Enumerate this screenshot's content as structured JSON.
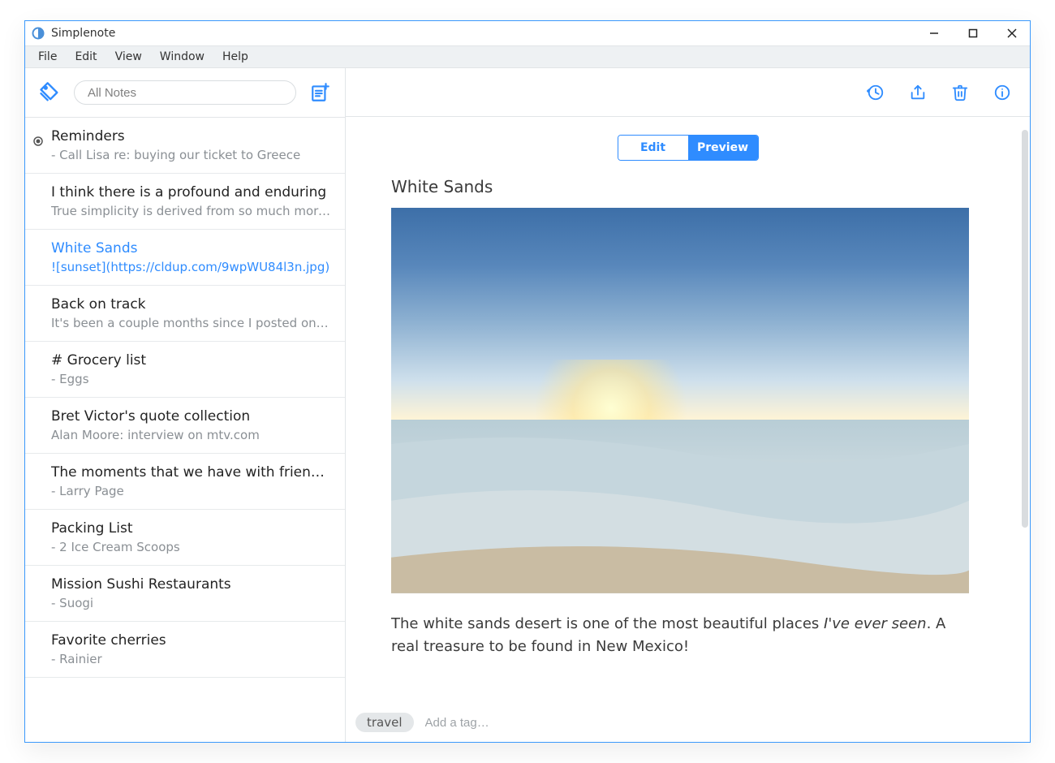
{
  "app_title": "Simplenote",
  "menu": [
    "File",
    "Edit",
    "View",
    "Window",
    "Help"
  ],
  "search_placeholder": "All Notes",
  "notes": [
    {
      "title": "Reminders",
      "snippet": "- Call Lisa re: buying our ticket to Greece",
      "pinned": true,
      "selected": false
    },
    {
      "title": "I think there is a profound and enduring",
      "snippet": "True simplicity is derived from so much more t…",
      "pinned": false,
      "selected": false
    },
    {
      "title": "White Sands",
      "snippet": "![sunset](https://cldup.com/9wpWU84l3n.jpg)",
      "pinned": false,
      "selected": true
    },
    {
      "title": "Back on track",
      "snippet": "It's been a couple months since I posted on my…",
      "pinned": false,
      "selected": false
    },
    {
      "title": "# Grocery list",
      "snippet": "- Eggs",
      "pinned": false,
      "selected": false
    },
    {
      "title": "Bret Victor's quote collection",
      "snippet": "Alan Moore: interview on mtv.com",
      "pinned": false,
      "selected": false
    },
    {
      "title": "The moments that we have with friends …",
      "snippet": "- Larry Page",
      "pinned": false,
      "selected": false
    },
    {
      "title": "Packing List",
      "snippet": "- 2 Ice Cream Scoops",
      "pinned": false,
      "selected": false
    },
    {
      "title": "Mission Sushi Restaurants",
      "snippet": "- Suogi",
      "pinned": false,
      "selected": false
    },
    {
      "title": "Favorite cherries",
      "snippet": "- Rainier",
      "pinned": false,
      "selected": false
    }
  ],
  "mode": {
    "edit": "Edit",
    "preview": "Preview"
  },
  "current_note": {
    "title": "White Sands",
    "body_pre": "The white sands desert is one of the most beautiful places ",
    "body_italic": "I've ever seen",
    "body_post": ". A real treasure to be found in New Mexico!"
  },
  "tags": [
    "travel"
  ],
  "tag_placeholder": "Add a tag…",
  "colors": {
    "accent": "#2f8cff"
  }
}
